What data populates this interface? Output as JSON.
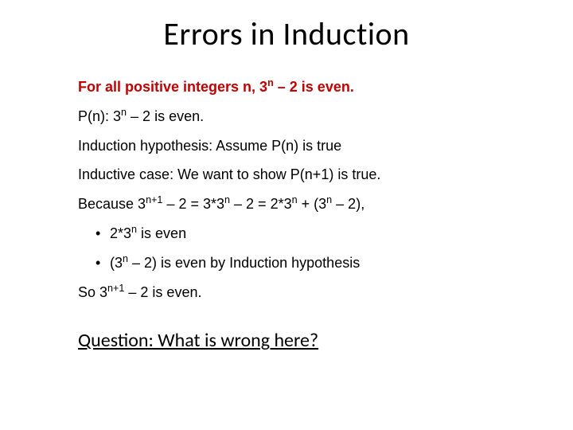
{
  "title": "Errors in Induction",
  "claim": {
    "prefix": "For all positive integers n, 3",
    "sup": "n",
    "suffix": " – 2 is even."
  },
  "lines": {
    "pn": {
      "a": "P(n): 3",
      "sup": "n",
      "b": " – 2 is even."
    },
    "hypothesis": "Induction hypothesis: Assume P(n) is true",
    "inductive": "Inductive case: We want to show P(n+1) is true.",
    "because": {
      "a": "Because 3",
      "s1": "n+1",
      "b": " – 2 = 3*3",
      "s2": "n",
      "c": " – 2 = 2*3",
      "s3": "n",
      "d": " + (3",
      "s4": "n",
      "e": " – 2),"
    },
    "bullet1": {
      "a": "2*3",
      "s": "n",
      "b": " is even"
    },
    "bullet2": {
      "a": "(3",
      "s": "n",
      "b": " – 2) is even by Induction hypothesis"
    },
    "so": {
      "a": "So 3",
      "s": "n+1",
      "b": " – 2 is even."
    }
  },
  "question": "Question: What is wrong here?"
}
